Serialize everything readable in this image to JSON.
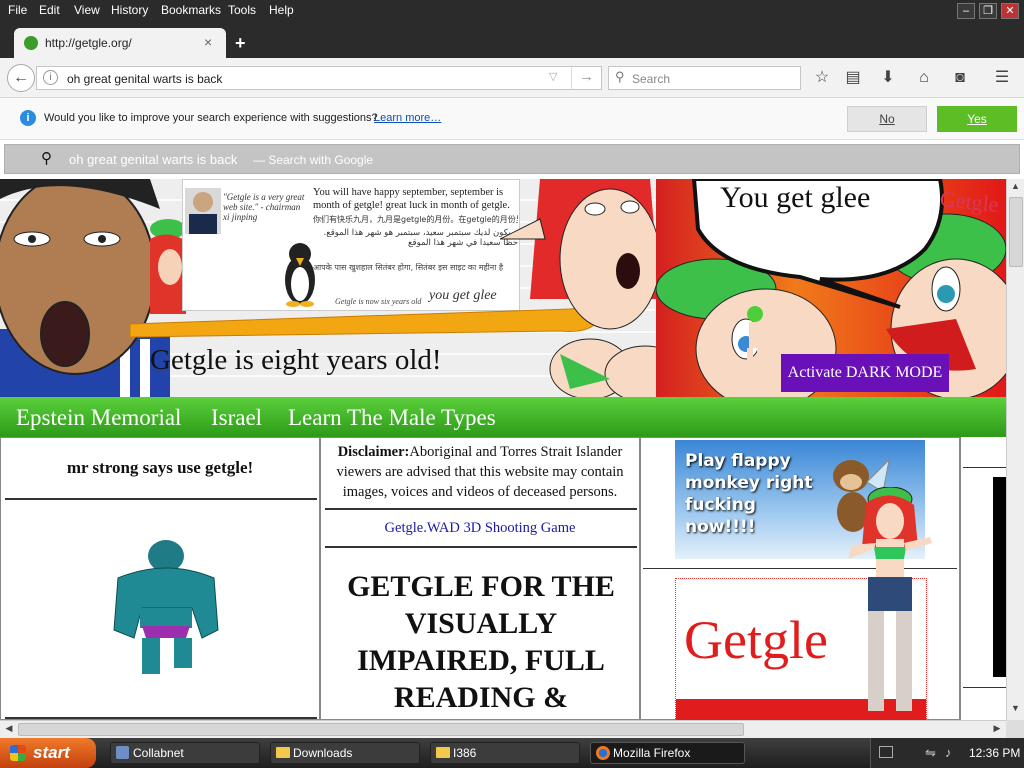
{
  "menu": [
    "File",
    "Edit",
    "View",
    "History",
    "Bookmarks",
    "Tools",
    "Help"
  ],
  "tab": {
    "title": "http://getgle.org/",
    "close": "×",
    "new_tab": "+"
  },
  "urlbar": {
    "value": "oh great genital warts is back"
  },
  "search": {
    "placeholder": "Search"
  },
  "suggest_bar": {
    "message": "Would you like to improve your search experience with suggestions?",
    "learn_more": "Learn more…",
    "no": "No",
    "yes": "Yes"
  },
  "dropdown": {
    "query": "oh great genital warts is back",
    "hint": "— Search with Google"
  },
  "banner": {
    "quote": "\"Getgle is a very great web site.\" - chairman xi jinping",
    "notice_en": "You will have happy september, september is month of getgle! great luck in month of getgle.",
    "notice_cn": "你们有快乐九月，九月是getgle的月份。在getgle的月份里祝你好运。",
    "notice_ar": "سيكون لديك سبتمبر سعيد، سبتمبر هو شهر هذا الموقع. حظا سعيدا في شهر هذا الموقع",
    "notice_hi": "आपके पास खुशहाल सितंबर होगा, सितंबर इस साइट का महीना है",
    "sign_footer": "Getgle is now six years old",
    "sign_glee": "you get glee",
    "speech": "You get glee",
    "cap_text": "Getgle",
    "headline": "Getgle is eight years old!",
    "dark_mode": "Activate DARK MODE"
  },
  "nav": [
    "Epstein Memorial",
    "Israel",
    "Learn The Male Types"
  ],
  "col1": {
    "heading": "mr strong says use getgle!"
  },
  "col2": {
    "disclaimer_label": "Disclaimer:",
    "disclaimer_text": "Aboriginal and Torres Strait Islander viewers are advised that this website may contain images, voices and videos of deceased persons.",
    "game_link": "Getgle.WAD 3D Shooting Game",
    "big_heading": "GETGLE FOR THE VISUALLY IMPAIRED, FULL READING &"
  },
  "col3": {
    "ad_text": "Play flappy monkey right fucking now!!!!",
    "logo_text": "Getgle"
  },
  "taskbar": {
    "start": "start",
    "items": [
      "Collabnet",
      "Downloads",
      "I386",
      "Mozilla Firefox"
    ],
    "clock": "12:36 PM"
  }
}
